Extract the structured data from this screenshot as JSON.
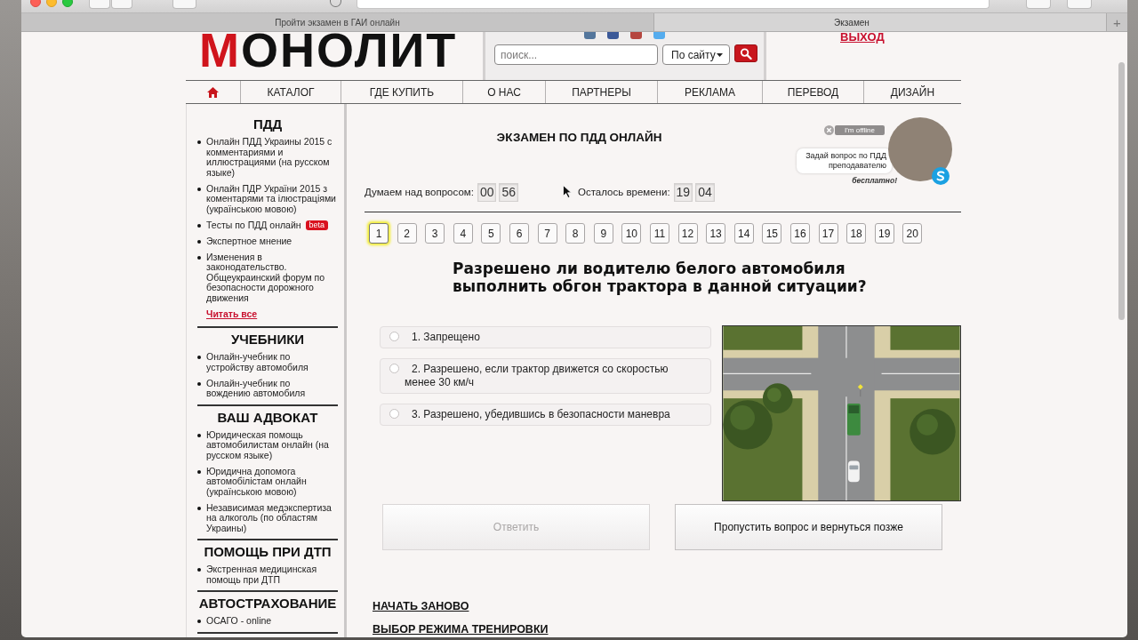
{
  "browser": {
    "tabs": [
      {
        "label": "Пройти экзамен в ГАИ онлайн",
        "selected": false
      },
      {
        "label": "Экзамен",
        "selected": true
      }
    ],
    "new_tab": "+"
  },
  "header": {
    "logo": {
      "accent": "М",
      "text": "ОНОЛИТ"
    },
    "search": {
      "placeholder": "поиск..."
    },
    "scope": "По сайту",
    "logout": "ВЫХОД"
  },
  "nav": [
    {
      "kind": "home"
    },
    {
      "kind": "link",
      "label": "КАТАЛОГ"
    },
    {
      "kind": "link",
      "label": "ГДЕ КУПИТЬ"
    },
    {
      "kind": "link",
      "label": "О НАС"
    },
    {
      "kind": "link",
      "label": "ПАРТНЕРЫ"
    },
    {
      "kind": "link",
      "label": "РЕКЛАМА"
    },
    {
      "kind": "link",
      "label": "ПЕРЕВОД"
    },
    {
      "kind": "link",
      "label": "ДИЗАЙН"
    }
  ],
  "sidebar": [
    {
      "title": "ПДД",
      "items": [
        {
          "text": "Онлайн ПДД Украины 2015 с комментариями и иллюстрациями (на русском языке)"
        },
        {
          "text": "Онлайн ПДР України 2015 з коментарями та ілюстраціями (українською мовою)"
        },
        {
          "text": "Тесты по ПДД онлайн",
          "badge": "beta"
        },
        {
          "text": "Экспертное мнение"
        },
        {
          "text": "Изменения в законодательство. Общеукраинский форум по безопасности дорожного движения"
        }
      ],
      "more": "Читать все"
    },
    {
      "title": "УЧЕБНИКИ",
      "items": [
        {
          "text": "Онлайн-учебник по устройству автомобиля"
        },
        {
          "text": "Онлайн-учебник по вождению автомобиля"
        }
      ]
    },
    {
      "title": "ВАШ АДВОКАТ",
      "items": [
        {
          "text": "Юридическая помощь автомобилистам онлайн (на русском языке)"
        },
        {
          "text": "Юридична допомога автомобілістам онлайн (українською мовою)"
        },
        {
          "text": "Независимая медэкспертиза на алкоголь (по областям Украины)"
        }
      ]
    },
    {
      "title": "ПОМОЩЬ ПРИ ДТП",
      "items": [
        {
          "text": "Экстренная медицинская помощь при ДТП"
        }
      ]
    },
    {
      "title": "АВТОСТРАХОВАНИЕ",
      "items": [
        {
          "text": "ОСАГО - online"
        }
      ]
    }
  ],
  "exam": {
    "title": "ЭКЗАМЕН ПО ПДД ОНЛАЙН",
    "timers": [
      {
        "label": "Думаем над вопросом:",
        "values": [
          "00",
          "56"
        ]
      },
      {
        "label": "Осталось времени:",
        "values": [
          "19",
          "04"
        ]
      }
    ],
    "questions": [
      {
        "label": "1",
        "selected": true
      },
      {
        "label": "2",
        "selected": false
      },
      {
        "label": "3",
        "selected": false
      },
      {
        "label": "4",
        "selected": false
      },
      {
        "label": "5",
        "selected": false
      },
      {
        "label": "6",
        "selected": false
      },
      {
        "label": "7",
        "selected": false
      },
      {
        "label": "8",
        "selected": false
      },
      {
        "label": "9",
        "selected": false
      },
      {
        "label": "10",
        "selected": false
      },
      {
        "label": "11",
        "selected": false
      },
      {
        "label": "12",
        "selected": false
      },
      {
        "label": "13",
        "selected": false
      },
      {
        "label": "14",
        "selected": false
      },
      {
        "label": "15",
        "selected": false
      },
      {
        "label": "16",
        "selected": false
      },
      {
        "label": "17",
        "selected": false
      },
      {
        "label": "18",
        "selected": false
      },
      {
        "label": "19",
        "selected": false
      },
      {
        "label": "20",
        "selected": false
      }
    ],
    "question": "Разрешено ли водителю белого автомобиля выполнить обгон трактора в данной ситуации?",
    "answers": [
      {
        "text": "1. Запрещено",
        "selected": false
      },
      {
        "text": "2. Разрешено, если трактор движется со скоростью менее 30 км/ч",
        "selected": false
      },
      {
        "text": "3. Разрешено, убедившись в безопасности маневра",
        "selected": false
      }
    ],
    "buttons": [
      {
        "label": "Ответить",
        "disabled": true
      },
      {
        "label": "Пропустить вопрос и вернуться позже",
        "disabled": false
      }
    ],
    "links": [
      "НАЧАТЬ ЗАНОВО",
      "ВЫБОР РЕЖИМА ТРЕНИРОВКИ"
    ]
  },
  "chat": {
    "status": "I'm offline",
    "prompt": "Задай вопрос по ПДД преподавателю",
    "note": "бесплатно!"
  }
}
